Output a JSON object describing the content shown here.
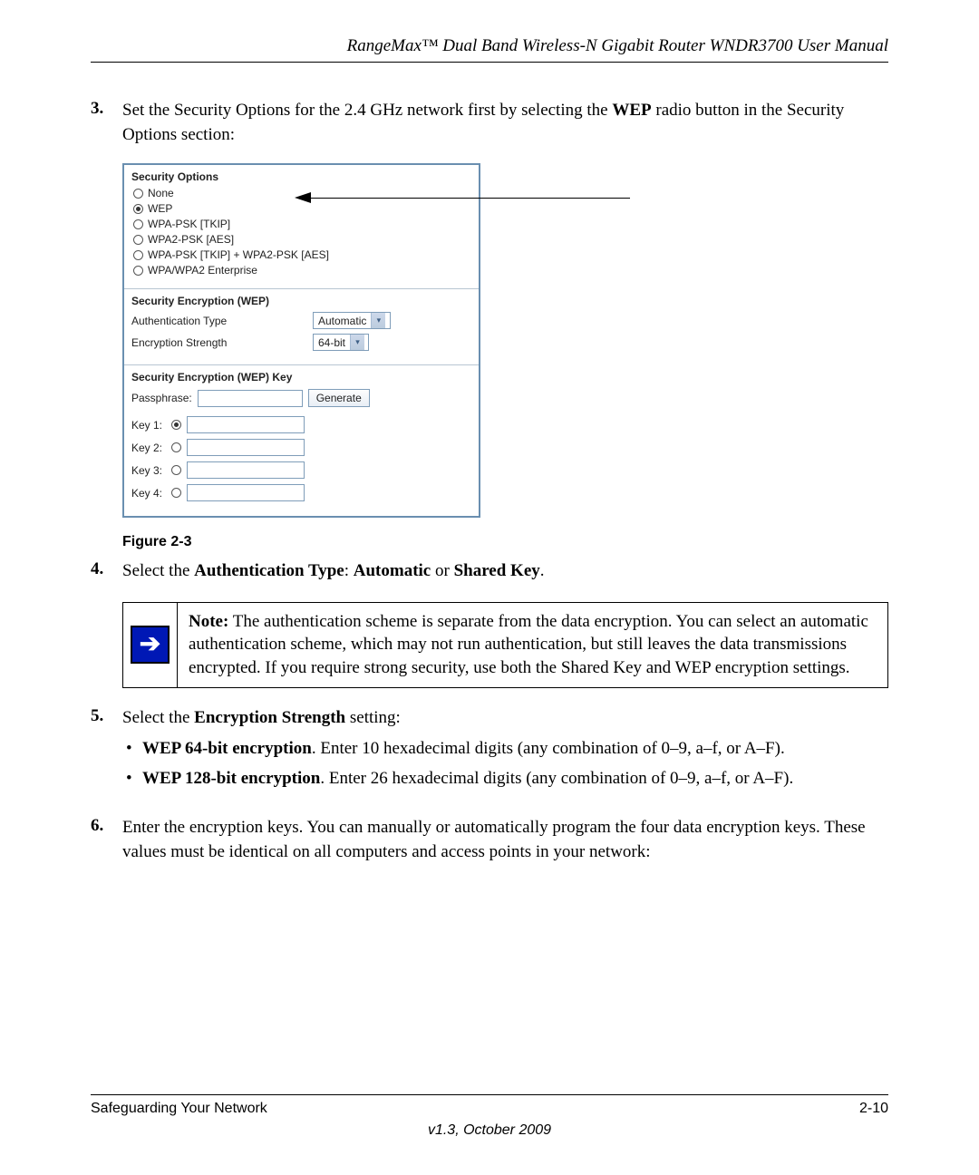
{
  "header": {
    "title": "RangeMax™ Dual Band Wireless-N Gigabit Router WNDR3700 User Manual"
  },
  "steps": {
    "s3": {
      "num": "3.",
      "pre": "Set the Security Options for the 2.4 GHz network first by selecting the ",
      "bold1": "WEP",
      "post": " radio button in the Security Options section:"
    },
    "s4": {
      "num": "4.",
      "pre": "Select the ",
      "b1": "Authentication Type",
      "mid": ": ",
      "b2": "Automatic",
      "or": " or ",
      "b3": "Shared Key",
      "end": "."
    },
    "s5": {
      "num": "5.",
      "pre": "Select the ",
      "b1": "Encryption Strength",
      "post": " setting:"
    },
    "s6": {
      "num": "6.",
      "text": "Enter the encryption keys. You can manually or automatically program the four data encryption keys. These values must be identical on all computers and access points in your network:"
    }
  },
  "panel": {
    "securityOptionsTitle": "Security Options",
    "options": {
      "none": "None",
      "wep": "WEP",
      "wpapsk": "WPA-PSK [TKIP]",
      "wpa2psk": "WPA2-PSK [AES]",
      "both": "WPA-PSK [TKIP] + WPA2-PSK [AES]",
      "enterprise": "WPA/WPA2 Enterprise"
    },
    "encTitle": "Security Encryption (WEP)",
    "authLabel": "Authentication Type",
    "authValue": "Automatic",
    "strLabel": "Encryption Strength",
    "strValue": "64-bit",
    "keyTitle": "Security Encryption (WEP) Key",
    "passLabel": "Passphrase:",
    "generate": "Generate",
    "key1": "Key 1:",
    "key2": "Key 2:",
    "key3": "Key 3:",
    "key4": "Key 4:"
  },
  "figureCaption": "Figure 2-3",
  "note": {
    "label": "Note:",
    "text": " The authentication scheme is separate from the data encryption. You can select an automatic authentication scheme, which may not run authentication, but still leaves the data transmissions encrypted. If you require strong security, use both the Shared Key and WEP encryption settings."
  },
  "bullets": {
    "b1a": "WEP 64-bit encryption",
    "b1b": ". Enter 10 hexadecimal digits (any combination of 0–9, a–f, or A–F).",
    "b2a": "WEP 128-bit encryption",
    "b2b": ". Enter 26 hexadecimal digits (any combination of 0–9, a–f, or A–F)."
  },
  "footer": {
    "left": "Safeguarding Your Network",
    "right": "2-10",
    "version": "v1.3, October 2009"
  }
}
